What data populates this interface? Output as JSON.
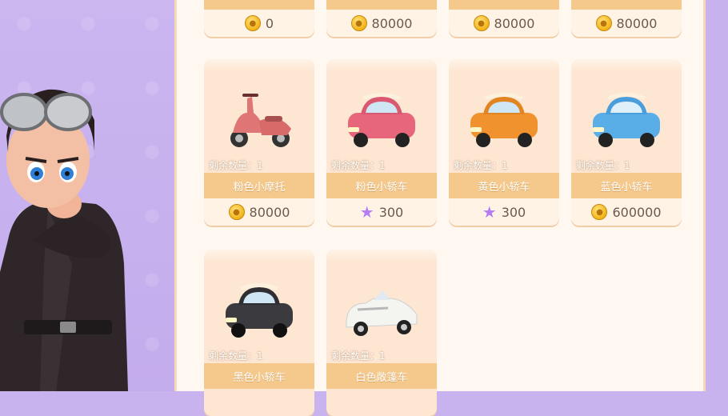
{
  "top_row": [
    {
      "price": "0",
      "currency": "coin-icon"
    },
    {
      "price": "80000",
      "currency": "coin-icon"
    },
    {
      "price": "80000",
      "currency": "coin-icon"
    },
    {
      "price": "80000",
      "currency": "coin-icon"
    }
  ],
  "items": [
    {
      "name": "粉色小摩托",
      "remain": "剩余数量：1",
      "price": "80000",
      "currency": "coin-icon",
      "vehicle": "pink-scooter",
      "color": "#e07575"
    },
    {
      "name": "粉色小轿车",
      "remain": "剩余数量：1",
      "price": "300",
      "currency": "star-icon",
      "vehicle": "pink-car",
      "color": "#e8667c"
    },
    {
      "name": "黄色小轿车",
      "remain": "剩余数量：1",
      "price": "300",
      "currency": "star-icon",
      "vehicle": "orange-car",
      "color": "#f0922e"
    },
    {
      "name": "蓝色小轿车",
      "remain": "剩余数量：1",
      "price": "600000",
      "currency": "coin-icon",
      "vehicle": "blue-car",
      "color": "#5aaee8"
    },
    {
      "name": "黑色小轿车",
      "remain": "剩余数量：1",
      "price": "",
      "currency": "",
      "vehicle": "black-car",
      "color": "#3b3b3f"
    },
    {
      "name": "白色敞篷车",
      "remain": "剩余数量：1",
      "price": "",
      "currency": "",
      "vehicle": "white-convertible",
      "color": "#f4f4f1"
    }
  ]
}
